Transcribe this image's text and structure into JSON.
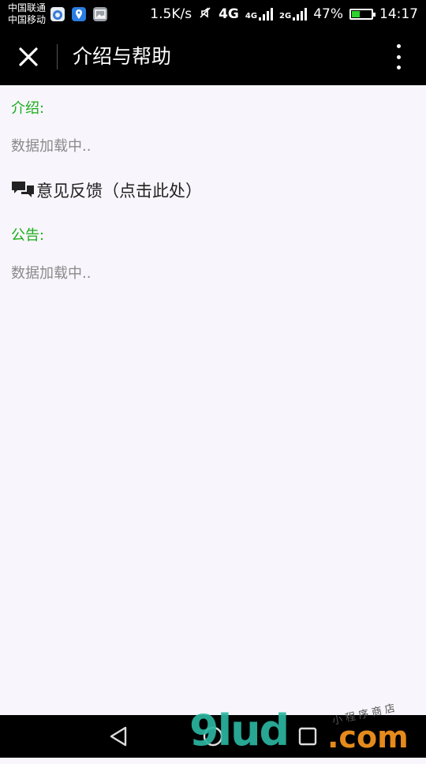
{
  "status_bar": {
    "carrier_1": "中国联通",
    "carrier_2": "中国移动",
    "speed": "1.5K/s",
    "network_a": "4G",
    "network_b": "4G",
    "network_c": "2G",
    "battery_percent": "47%",
    "battery_level": 0.47,
    "time": "14:17"
  },
  "header": {
    "title": "介绍与帮助",
    "close_icon": "close-icon",
    "more_icon": "more-vertical-icon"
  },
  "intro": {
    "label": "介绍:",
    "loading_text": "数据加载中.."
  },
  "feedback": {
    "icon": "chat-bubbles-icon",
    "label": "意见反馈（点击此处）"
  },
  "notice": {
    "label": "公告:",
    "loading_text": "数据加载中.."
  },
  "nav_bar": {
    "back_icon": "back-triangle-icon",
    "home_icon": "home-circle-icon",
    "recents_icon": "recents-square-icon"
  },
  "watermark": {
    "main": "9lud",
    "suffix": ".com",
    "small": "小程序商店"
  },
  "colors": {
    "accent_green": "#1aad19",
    "header_bg": "#000000",
    "page_bg": "#f8f6fc",
    "muted_text": "#8a8a8a"
  }
}
